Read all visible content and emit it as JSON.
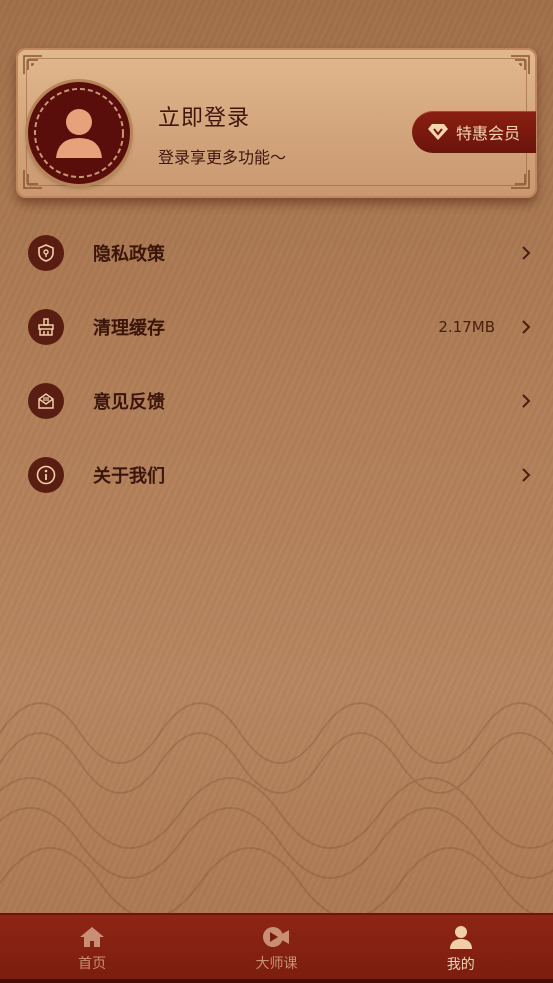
{
  "profile": {
    "login_title": "立即登录",
    "login_subtitle": "登录享更多功能～",
    "vip_label": "特惠会员"
  },
  "menu": {
    "items": [
      {
        "label": "隐私政策",
        "value": "",
        "icon": "shield-icon"
      },
      {
        "label": "清理缓存",
        "value": "2.17MB",
        "icon": "broom-icon"
      },
      {
        "label": "意见反馈",
        "value": "",
        "icon": "mail-icon"
      },
      {
        "label": "关于我们",
        "value": "",
        "icon": "info-icon"
      }
    ]
  },
  "tabbar": {
    "tabs": [
      {
        "label": "首页",
        "icon": "home-icon",
        "active": false
      },
      {
        "label": "大师课",
        "icon": "video-icon",
        "active": false
      },
      {
        "label": "我的",
        "icon": "person-icon",
        "active": true
      }
    ]
  },
  "colors": {
    "accent": "#7a1d0f",
    "card": "#d3a57c",
    "icon_bg": "#5a1d12"
  }
}
